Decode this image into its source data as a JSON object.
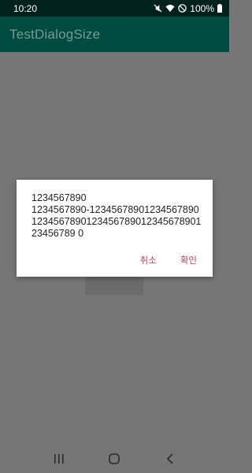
{
  "status_bar": {
    "time": "10:20",
    "battery": "100%",
    "icons": [
      "mute-icon",
      "wifi-icon",
      "dnd-icon",
      "battery-icon"
    ]
  },
  "app_bar": {
    "title": "TestDialogSize"
  },
  "dialog": {
    "message_line1": "1234567890",
    "message_line2": "1234567890-1234567890123456789012345678901234567890123456789012345678 90",
    "message_text": "1234567890-12345678901234567890123456789012345678901234567890123456789 0",
    "cancel_label": "취소",
    "ok_label": "확인"
  },
  "nav_bar": {
    "icons": [
      "recents-icon",
      "home-icon",
      "back-icon"
    ]
  },
  "colors": {
    "status_bar_bg": "#00211c",
    "app_bar_bg": "#004b40",
    "dialog_button": "#b8435c",
    "scrim": "#767676"
  }
}
